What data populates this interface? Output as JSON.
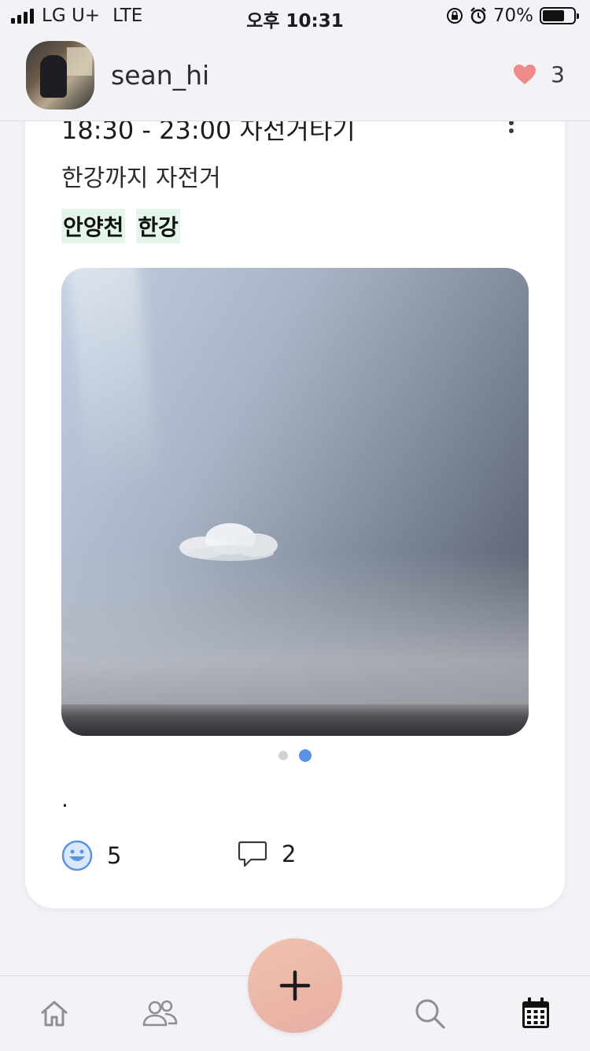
{
  "status_bar": {
    "carrier": "LG U+",
    "network": "LTE",
    "time": "오후 10:31",
    "battery": "70%",
    "battery_level": 0.7
  },
  "header": {
    "username": "sean_hi",
    "like_count": "3",
    "icons": {
      "like": "heart-icon"
    },
    "accent_color": "#ef8a8a"
  },
  "post": {
    "time_title": "18:30 - 23:00  자전거타기",
    "description": "한강까지 자전거",
    "tags": [
      "안양천",
      "한강"
    ],
    "carousel": {
      "count": 2,
      "active_index": 1
    },
    "caption": ".",
    "reactions": {
      "smile_count": "5",
      "comment_count": "2"
    },
    "icons": {
      "more": "more-vertical-icon",
      "smile": "smile-icon",
      "comment": "comment-icon"
    }
  },
  "tabbar": {
    "items": [
      "home-icon",
      "friends-icon",
      "add-icon",
      "search-icon",
      "calendar-icon"
    ],
    "active": "calendar-icon",
    "fab_color": "#ebb6a8"
  }
}
